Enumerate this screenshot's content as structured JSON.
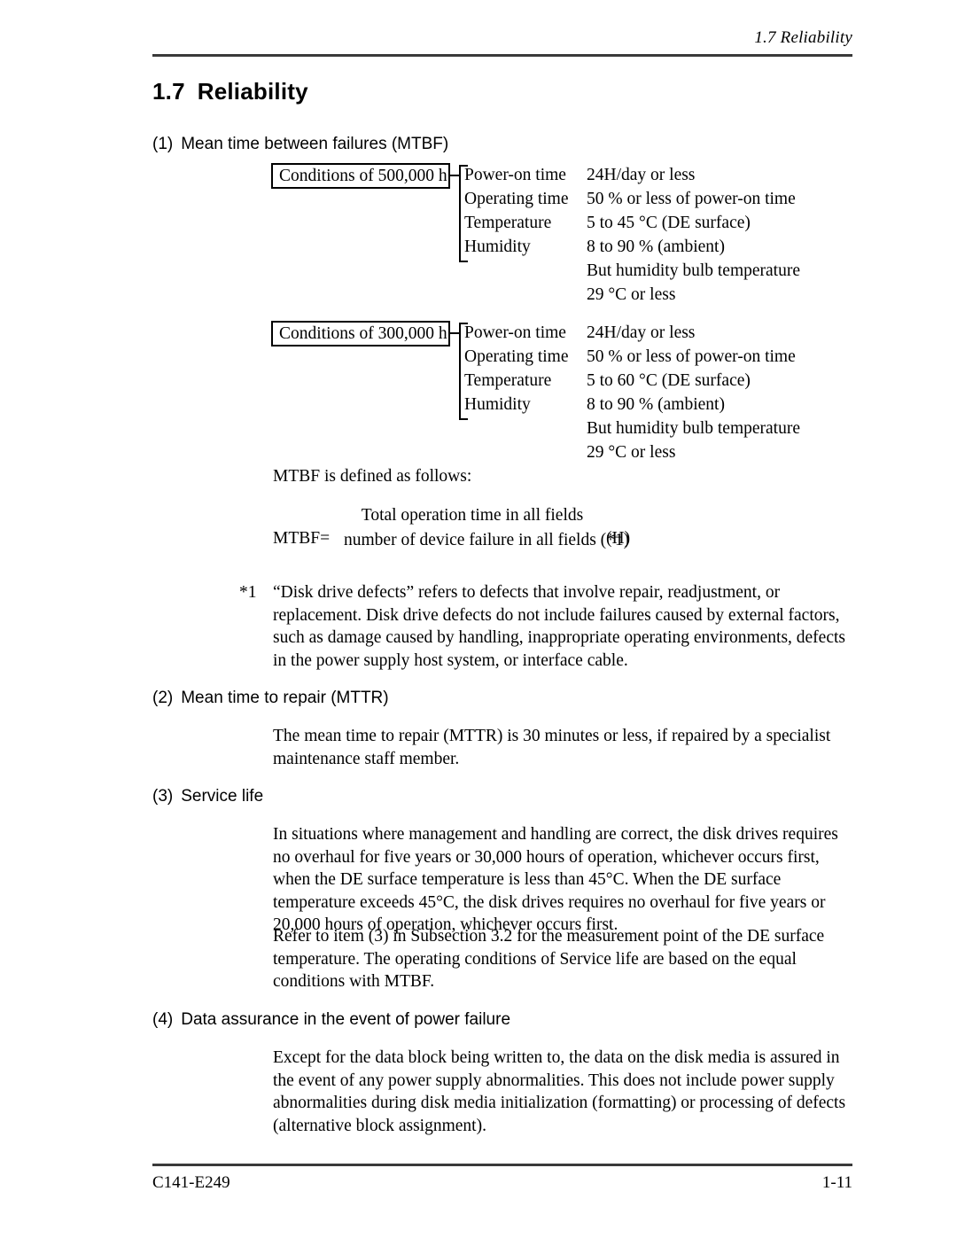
{
  "header": {
    "running_title": "1.7  Reliability"
  },
  "section": {
    "number": "1.7",
    "title": "Reliability"
  },
  "items": [
    {
      "label": "(1)",
      "title": "Mean time between failures (MTBF)"
    },
    {
      "label": "(2)",
      "title": "Mean time to repair (MTTR)"
    },
    {
      "label": "(3)",
      "title": "Service life"
    },
    {
      "label": "(4)",
      "title": "Data assurance in the event of power failure"
    }
  ],
  "condition_blocks": [
    {
      "box_label": "Conditions of 500,000 h",
      "rows": [
        {
          "label": "Power-on time",
          "value": "24H/day or less"
        },
        {
          "label": "Operating time",
          "value": "50 % or less of power-on time"
        },
        {
          "label": "Temperature",
          "value": "5 to 45 °C (DE surface)"
        },
        {
          "label": "Humidity",
          "value": "8 to 90 % (ambient)"
        },
        {
          "label": "",
          "value": "But humidity bulb temperature"
        },
        {
          "label": "",
          "value": "29 °C or less"
        }
      ]
    },
    {
      "box_label": "Conditions of 300,000 h",
      "rows": [
        {
          "label": "Power-on time",
          "value": "24H/day or less"
        },
        {
          "label": "Operating time",
          "value": "50 % or less of power-on time"
        },
        {
          "label": "Temperature",
          "value": "5 to 60 °C (DE surface)"
        },
        {
          "label": "Humidity",
          "value": "8 to 90 % (ambient)"
        },
        {
          "label": "",
          "value": "But humidity bulb temperature"
        },
        {
          "label": "",
          "value": "29 °C or less"
        }
      ]
    }
  ],
  "formula": {
    "intro": "MTBF is defined as follows:",
    "lhs": "MTBF=",
    "numerator": "Total operation time in all fields",
    "denominator": "number of device failure in all fields (*1)",
    "unit": "(H)"
  },
  "footnote": {
    "marker": "*1",
    "text": "“Disk drive defects” refers to defects that involve repair, readjustment, or replacement.  Disk drive defects do not include failures caused by external factors, such as damage caused by handling, inappropriate operating environments, defects in the power supply host system, or interface cable."
  },
  "paragraphs": {
    "mttr": "The mean time to repair (MTTR) is 30 minutes or less, if repaired by a specialist maintenance staff member.",
    "service_life": "In situations where management and handling are correct, the disk drives requires no overhaul for five years or 30,000 hours of operation, whichever occurs first, when the DE surface temperature is less than 45°C.  When the DE surface temperature exceeds 45°C, the disk drives requires no overhaul for five years or 20,000 hours of operation, whichever occurs first.",
    "service_life_2": "Refer to item (3) in Subsection 3.2 for the measurement point of the DE surface temperature.  The operating conditions of Service life are based on the equal conditions with MTBF.",
    "data_assurance": "Except for the data block being written to, the data on the disk media is assured in the event of any power supply abnormalities.  This does not include power supply abnormalities during disk media initialization (formatting) or processing of defects (alternative block assignment)."
  },
  "footer": {
    "doc_number": "C141-E249",
    "page_number": "1-11"
  }
}
